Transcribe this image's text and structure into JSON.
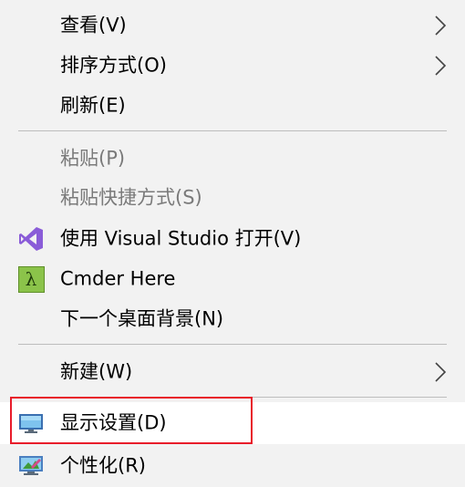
{
  "menu": {
    "items": [
      {
        "label": "查看(V)"
      },
      {
        "label": "排序方式(O)"
      },
      {
        "label": "刷新(E)"
      },
      {
        "label": "粘贴(P)"
      },
      {
        "label": "粘贴快捷方式(S)"
      },
      {
        "label": "使用 Visual Studio 打开(V)"
      },
      {
        "label": "Cmder Here"
      },
      {
        "label": "下一个桌面背景(N)"
      },
      {
        "label": "新建(W)"
      },
      {
        "label": "显示设置(D)"
      },
      {
        "label": "个性化(R)"
      }
    ],
    "cmder_glyph": "λ"
  },
  "icons": {
    "visual_studio": "visual-studio-icon",
    "cmder": "cmder-icon",
    "display": "display-settings-icon",
    "personalize": "personalize-icon",
    "submenu": "chevron-right-icon"
  },
  "colors": {
    "menu_bg": "#f2f2f2",
    "hover_bg": "#ffffff",
    "disabled_text": "#7a7a7a",
    "highlight_border": "#e81c2a",
    "vs_purple": "#8a5cd8",
    "cmder_green": "#8bc34a"
  }
}
